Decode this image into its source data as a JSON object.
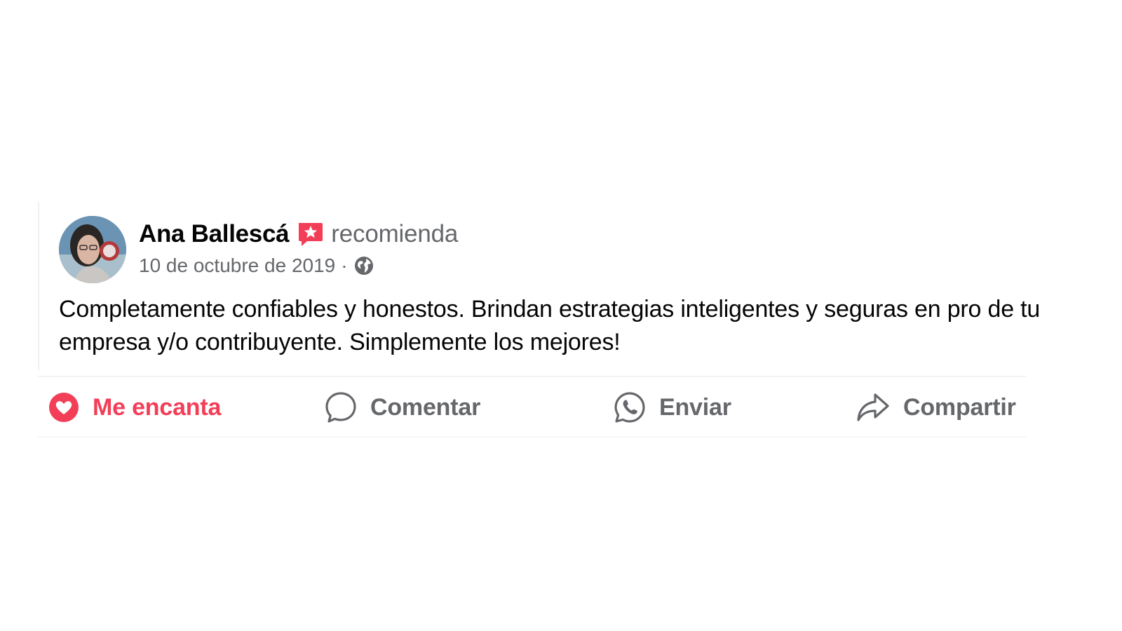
{
  "review": {
    "author_name": "Ana Ballescá",
    "recommend_label": "recomienda",
    "date": "10 de octubre de 2019",
    "separator": "·",
    "privacy_icon": "globe-icon",
    "text": "Completamente confiables y honestos. Brindan estrategias inteligentes y seguras en pro de tu empresa y/o contribuyente. Simplemente los mejores!"
  },
  "actions": {
    "love": {
      "label": "Me encanta",
      "icon": "heart-icon",
      "active": true
    },
    "comment": {
      "label": "Comentar",
      "icon": "comment-icon"
    },
    "send": {
      "label": "Enviar",
      "icon": "whatsapp-icon"
    },
    "share": {
      "label": "Compartir",
      "icon": "share-icon"
    }
  },
  "colors": {
    "love_active": "#f33e58",
    "text_primary": "#050505",
    "text_secondary": "#65676b",
    "recommend_badge": "#f33e58"
  }
}
